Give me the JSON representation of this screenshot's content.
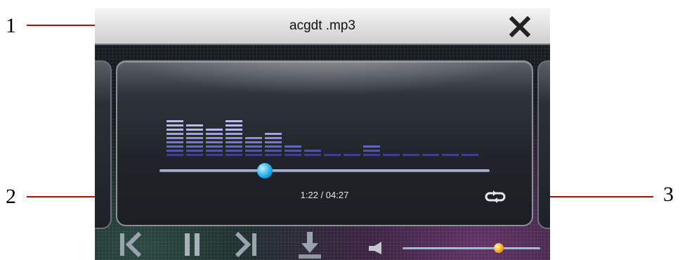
{
  "player": {
    "title": "acgdt .mp3",
    "time_display": "1:22 / 04:27",
    "progress_fraction": 0.32,
    "volume_fraction": 0.7
  },
  "equalizer": {
    "levels": [
      9,
      8,
      7,
      9,
      5,
      6,
      3,
      2,
      1,
      1,
      3,
      1,
      1,
      1,
      1,
      1
    ],
    "colors": {
      "low": "#3b36c8",
      "high": "#b8b6f4"
    }
  },
  "controls": {
    "icons": [
      "previous-icon",
      "pause-icon",
      "next-icon",
      "download-icon",
      "speaker-icon"
    ]
  },
  "callouts": [
    "1",
    "2",
    "3"
  ],
  "colors": {
    "seek_knob": "#19a6e6",
    "volume_knob": "#f2a21b",
    "callout_line": "#cc0000"
  }
}
